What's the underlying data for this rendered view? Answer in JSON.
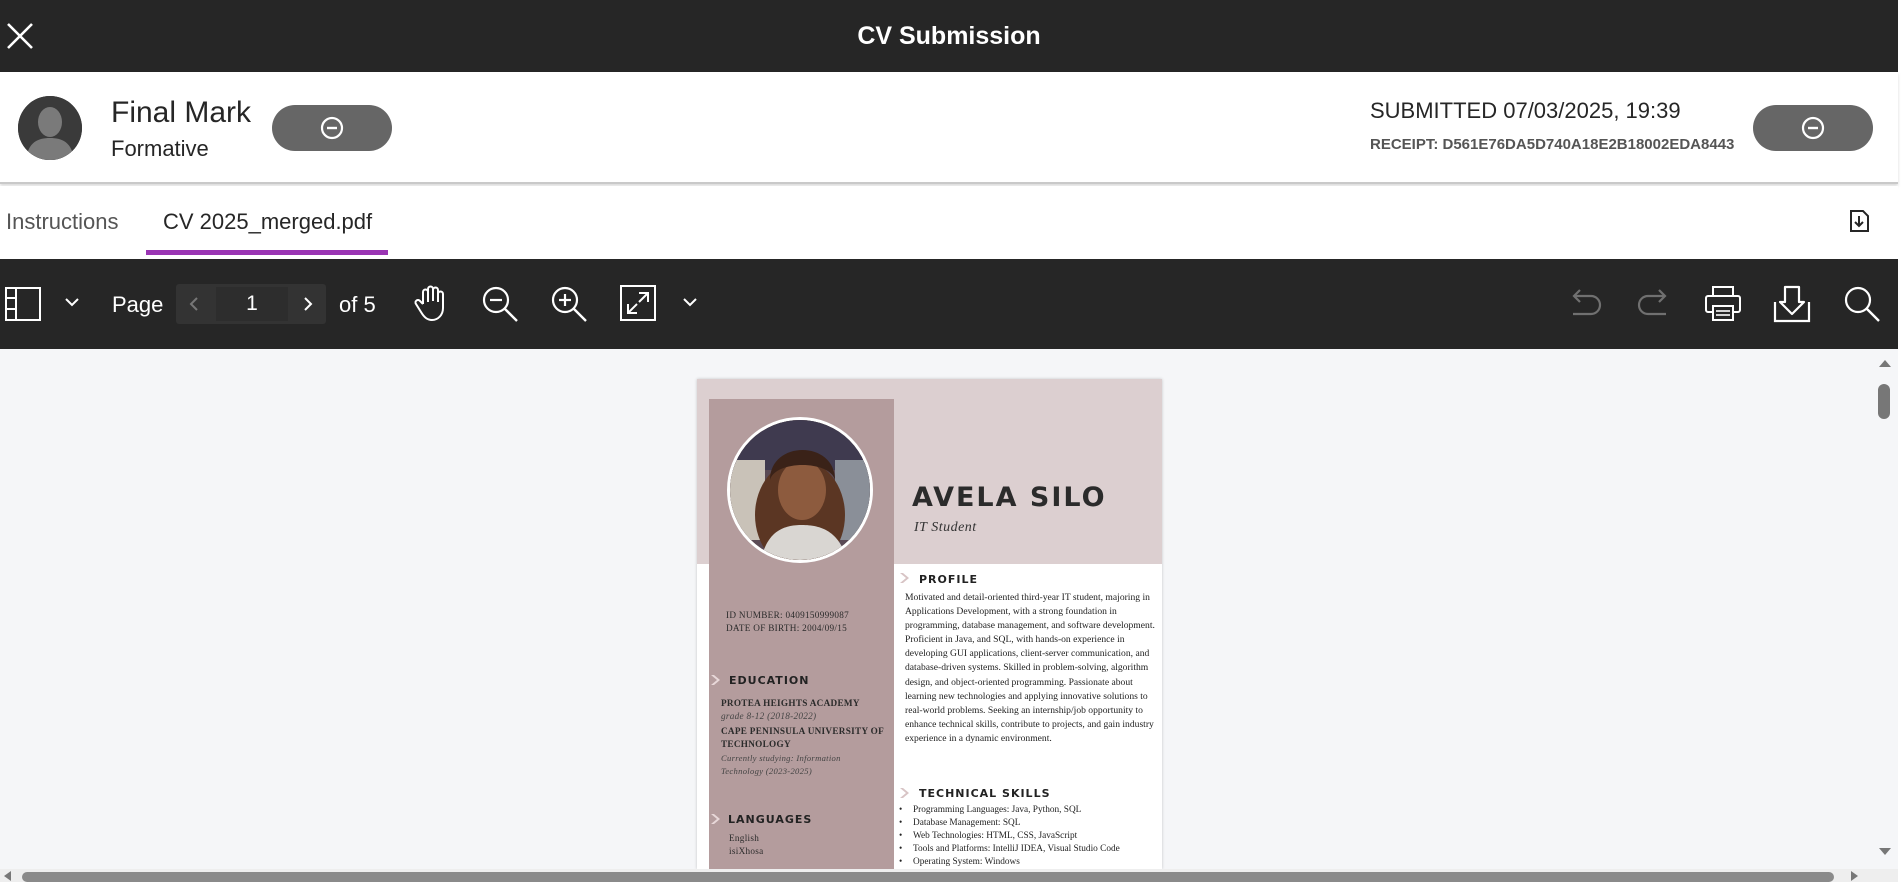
{
  "titlebar": {
    "title": "CV Submission"
  },
  "header": {
    "mark_title": "Final Mark",
    "mark_sub": "Formative",
    "submitted": "SUBMITTED 07/03/2025, 19:39",
    "receipt": "RECEIPT: D561E76DA5D740A18E2B18002EDA8443"
  },
  "tabs": [
    {
      "label": "Instructions",
      "active": false
    },
    {
      "label": "CV 2025_merged.pdf",
      "active": true
    }
  ],
  "toolbar": {
    "page_label": "Page",
    "current_page": "1",
    "of_label": "of 5"
  },
  "colors": {
    "accent": "#9a35b3",
    "bar": "#262626",
    "cv_band": "#dccfd0",
    "cv_side": "#b49c9d"
  },
  "cv": {
    "name": "AVELA SILO",
    "role": "IT Student",
    "id_number": "ID NUMBER: 0409150999087",
    "dob": "DATE OF BIRTH: 2004/09/15",
    "education_h": "EDUCATION",
    "edu1_school": "PROTEA HEIGHTS ACADEMY",
    "edu1_detail": "grade 8-12 (2018-2022)",
    "edu2_school_a": "CAPE PENINSULA UNIVERSITY OF",
    "edu2_school_b": "TECHNOLOGY",
    "edu2_detail_a": "Currently studying: Information",
    "edu2_detail_b": "Technology (2023-2025)",
    "languages_h": "LANGUAGES",
    "lang1": "English",
    "lang2": "isiXhosa",
    "profile_h": "PROFILE",
    "profile": "Motivated and detail-oriented third-year IT student, majoring in Applications Development, with a strong foundation in programming, database management, and software development. Proficient in Java, and SQL, with hands-on experience in developing GUI applications, client-server communication, and database-driven systems. Skilled in problem-solving, algorithm design, and object-oriented programming. Passionate about learning new technologies and applying innovative solutions to real-world problems. Seeking an internship/job opportunity to enhance technical skills, contribute to projects, and gain industry experience in a dynamic environment.",
    "skills_h": "TECHNICAL SKILLS",
    "skills": [
      "Programming Languages: Java, Python, SQL",
      "Database Management: SQL",
      "Web Technologies: HTML, CSS, JavaScript",
      "Tools and Platforms: IntelliJ IDEA, Visual Studio Code",
      "Operating System: Windows"
    ]
  }
}
